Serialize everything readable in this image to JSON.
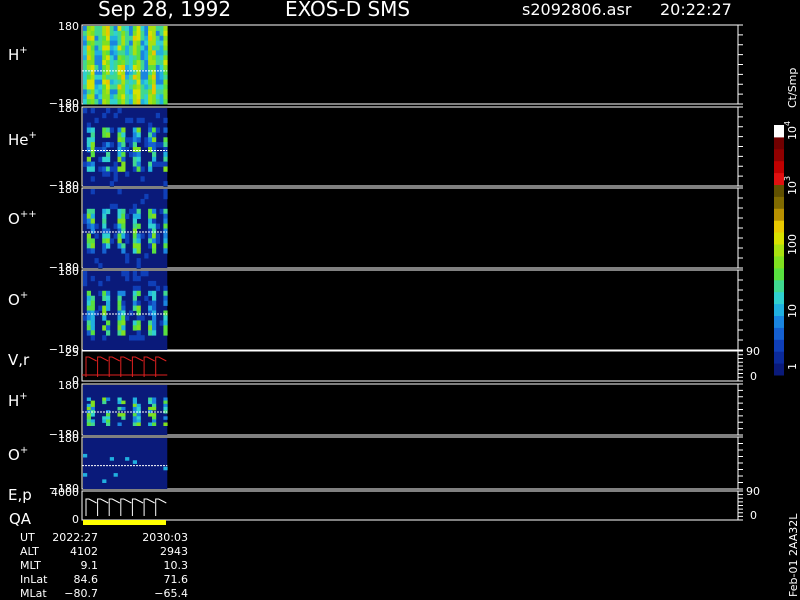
{
  "header": {
    "date": "Sep 28, 1992",
    "instrument": "EXOS-D SMS",
    "file": "s2092806.asr",
    "time": "20:22:27"
  },
  "colorbar": {
    "unit": "Ct/Smp",
    "ticks": [
      "1",
      "10",
      "100",
      "10",
      "10"
    ],
    "tick_exponents": [
      "",
      "",
      "",
      "3",
      "4"
    ],
    "colors": [
      "#0a1a7a",
      "#0b2a9a",
      "#0f3fb8",
      "#1560d0",
      "#1a85e0",
      "#20b0e0",
      "#30d0d0",
      "#40d890",
      "#58e040",
      "#80e020",
      "#a8e010",
      "#d8e000",
      "#e8c800",
      "#b89000",
      "#806a00",
      "#605000",
      "#e01010",
      "#c00000",
      "#900000",
      "#700000",
      "#ffffff"
    ]
  },
  "chart_data": [
    {
      "type": "heatmap",
      "panel_label": "H",
      "superscript": "+",
      "ylim": [
        -180,
        180
      ],
      "ytick_top": "180",
      "ytick_bottom": "−180",
      "x_extent_fraction": 0.13
    },
    {
      "type": "heatmap",
      "panel_label": "He",
      "superscript": "+",
      "ylim": [
        -180,
        180
      ],
      "ytick_top": "180",
      "ytick_bottom": "−180",
      "x_extent_fraction": 0.13
    },
    {
      "type": "heatmap",
      "panel_label": "O",
      "superscript": "++",
      "ylim": [
        -180,
        180
      ],
      "ytick_top": "180",
      "ytick_bottom": "−180",
      "x_extent_fraction": 0.13
    },
    {
      "type": "heatmap",
      "panel_label": "O",
      "superscript": "+",
      "ylim": [
        -180,
        180
      ],
      "ytick_top": "180",
      "ytick_bottom": "−180",
      "x_extent_fraction": 0.13
    },
    {
      "type": "line",
      "panel_label": "V,r",
      "ylim": [
        0,
        25
      ],
      "ytick_top": "25",
      "ytick_bottom": "0",
      "right_ticks": [
        "90",
        "0"
      ]
    },
    {
      "type": "heatmap",
      "panel_label": "H",
      "superscript": "+",
      "ylim": [
        -180,
        180
      ],
      "ytick_top": "180",
      "ytick_bottom": "−180",
      "x_extent_fraction": 0.13
    },
    {
      "type": "heatmap",
      "panel_label": "O",
      "superscript": "+",
      "ylim": [
        -180,
        180
      ],
      "ytick_top": "180",
      "ytick_bottom": "−180",
      "x_extent_fraction": 0.13
    },
    {
      "type": "line",
      "panel_label": "E,p",
      "ylim": [
        0,
        4000
      ],
      "ytick_top": "4000",
      "ytick_bottom": "0",
      "right_ticks": [
        "90",
        "0"
      ]
    }
  ],
  "qa_label": "QA",
  "ephemeris": {
    "rows": [
      {
        "label": "UT",
        "start": "2022:27",
        "end": "2030:03"
      },
      {
        "label": "ALT",
        "start": "4102",
        "end": "2943"
      },
      {
        "label": "MLT",
        "start": "9.1",
        "end": "10.3"
      },
      {
        "label": "InLat",
        "start": "84.6",
        "end": "71.6"
      },
      {
        "label": "MLat",
        "start": "−80.7",
        "end": "−65.4"
      }
    ]
  },
  "footer_vertical": "Feb-01 2AA32L"
}
